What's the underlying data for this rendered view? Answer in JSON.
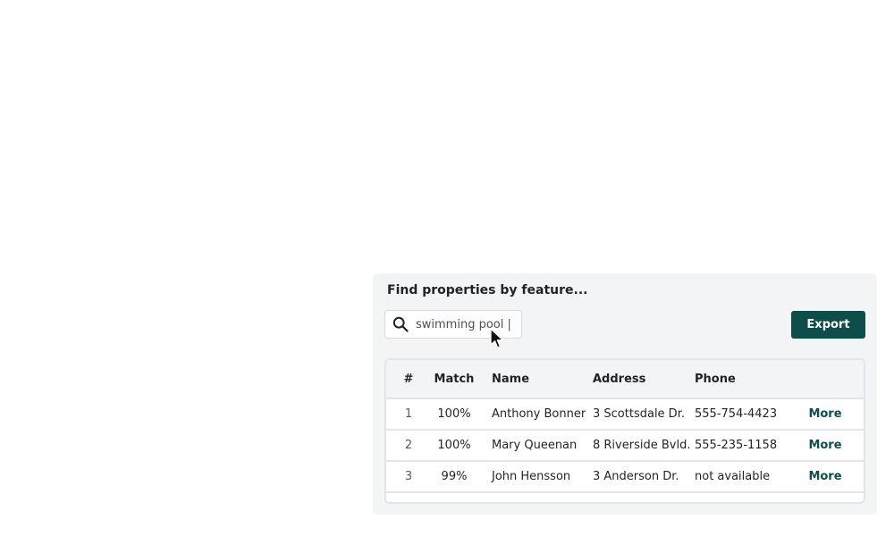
{
  "panel": {
    "title": "Find properties by feature..."
  },
  "search": {
    "value": "swimming pool |",
    "icon": "search-icon"
  },
  "toolbar": {
    "export_label": "Export",
    "accent": "#0e4d4a"
  },
  "table": {
    "columns": [
      "#",
      "Match",
      "Name",
      "Address",
      "Phone",
      ""
    ],
    "rows": [
      {
        "num": "1",
        "match": "100%",
        "name": "Anthony Bonner",
        "address": "3 Scottsdale Dr.",
        "phone": "555-754-4423",
        "more": "More"
      },
      {
        "num": "2",
        "match": "100%",
        "name": "Mary Queenan",
        "address": "8 Riverside Bvld.",
        "phone": "555-235-1158",
        "more": "More"
      },
      {
        "num": "3",
        "match": "99%",
        "name": "John Hensson",
        "address": "3 Anderson Dr.",
        "phone": "not available",
        "more": "More"
      }
    ]
  }
}
